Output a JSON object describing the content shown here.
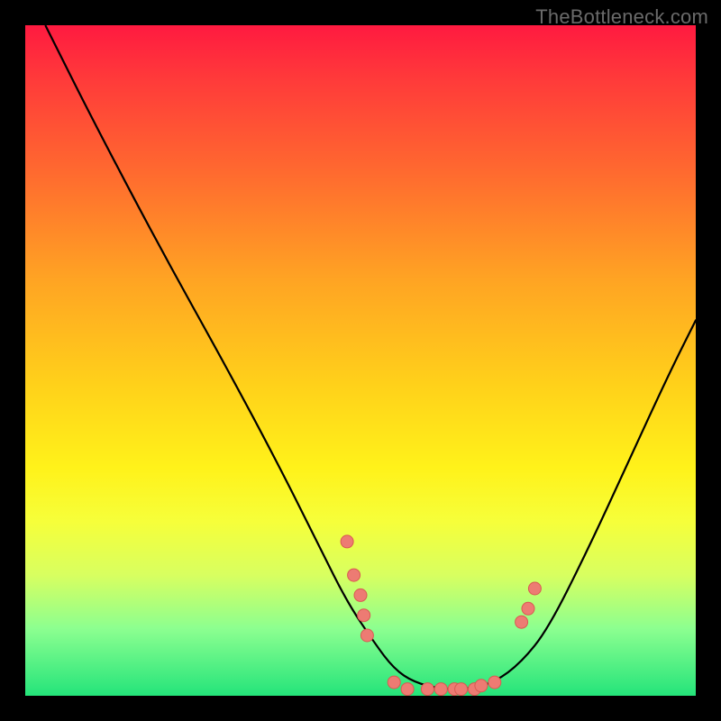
{
  "watermark": "TheBottleneck.com",
  "chart_data": {
    "type": "line",
    "title": "",
    "xlabel": "",
    "ylabel": "",
    "xlim": [
      0,
      100
    ],
    "ylim": [
      0,
      100
    ],
    "curve": [
      {
        "x": 3,
        "y": 100
      },
      {
        "x": 10,
        "y": 86
      },
      {
        "x": 20,
        "y": 67
      },
      {
        "x": 30,
        "y": 49
      },
      {
        "x": 38,
        "y": 34
      },
      {
        "x": 44,
        "y": 22
      },
      {
        "x": 48,
        "y": 14
      },
      {
        "x": 52,
        "y": 8
      },
      {
        "x": 55,
        "y": 4
      },
      {
        "x": 58,
        "y": 2
      },
      {
        "x": 62,
        "y": 1
      },
      {
        "x": 66,
        "y": 1
      },
      {
        "x": 70,
        "y": 2
      },
      {
        "x": 74,
        "y": 5
      },
      {
        "x": 78,
        "y": 10
      },
      {
        "x": 84,
        "y": 22
      },
      {
        "x": 90,
        "y": 35
      },
      {
        "x": 96,
        "y": 48
      },
      {
        "x": 100,
        "y": 56
      }
    ],
    "points": [
      {
        "x": 48,
        "y": 23
      },
      {
        "x": 49,
        "y": 18
      },
      {
        "x": 50,
        "y": 15
      },
      {
        "x": 50.5,
        "y": 12
      },
      {
        "x": 51,
        "y": 9
      },
      {
        "x": 55,
        "y": 2
      },
      {
        "x": 57,
        "y": 1
      },
      {
        "x": 60,
        "y": 1
      },
      {
        "x": 62,
        "y": 1
      },
      {
        "x": 64,
        "y": 1
      },
      {
        "x": 65,
        "y": 1
      },
      {
        "x": 67,
        "y": 1
      },
      {
        "x": 68,
        "y": 1.5
      },
      {
        "x": 70,
        "y": 2
      },
      {
        "x": 74,
        "y": 11
      },
      {
        "x": 75,
        "y": 13
      },
      {
        "x": 76,
        "y": 16
      }
    ],
    "colors": {
      "curve": "#000000",
      "points": "#ed7b73",
      "gradient_top": "#ff1a40",
      "gradient_bottom": "#24e47a"
    }
  }
}
